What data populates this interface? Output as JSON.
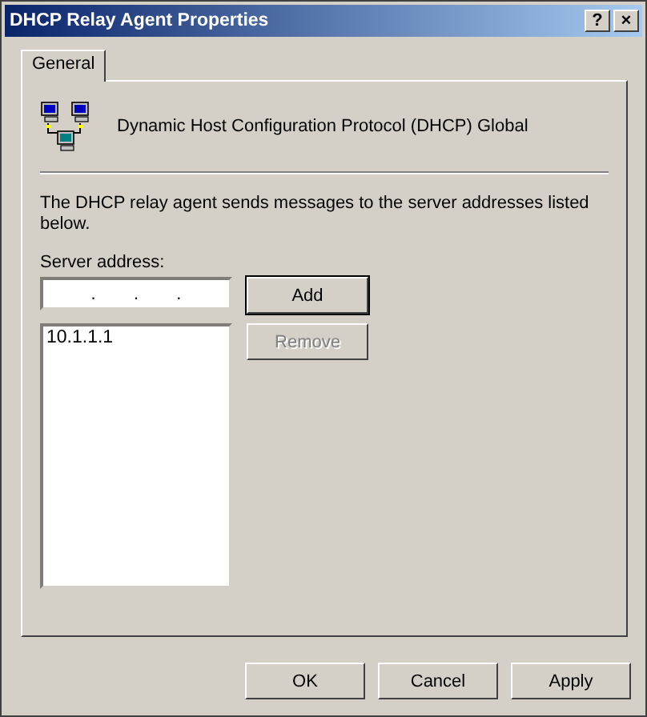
{
  "window": {
    "title": "DHCP Relay Agent Properties",
    "help_button": "?",
    "close_button": "×"
  },
  "tabs": [
    {
      "label": "General",
      "selected": true
    }
  ],
  "header": {
    "title": "Dynamic Host Configuration Protocol (DHCP) Global"
  },
  "description": "The DHCP relay agent sends messages to the server addresses listed below.",
  "server_address": {
    "label": "Server address:",
    "separator": "."
  },
  "add_button": {
    "label": "Add",
    "disabled": false
  },
  "remove_button": {
    "label": "Remove",
    "disabled": true
  },
  "servers": [
    {
      "address": "10.1.1.1",
      "selected": false
    }
  ],
  "buttons": [
    {
      "label": "OK",
      "disabled": false
    },
    {
      "label": "Cancel",
      "disabled": false
    },
    {
      "label": "Apply",
      "disabled": false
    }
  ]
}
